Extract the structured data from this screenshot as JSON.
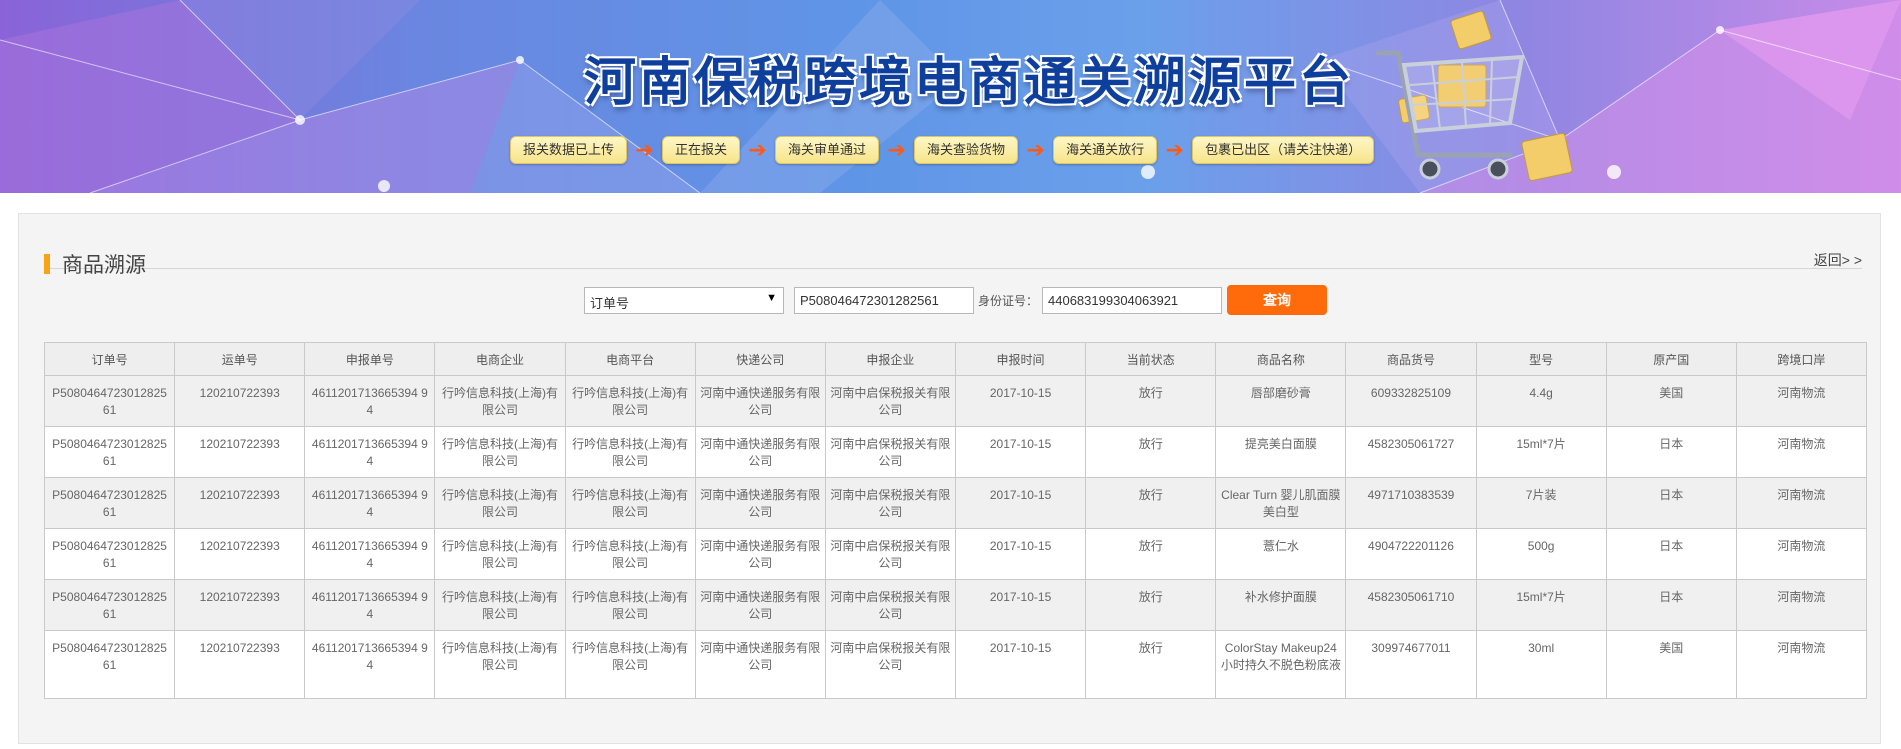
{
  "banner": {
    "title": "河南保税跨境电商通关溯源平台",
    "steps": [
      "报关数据已上传",
      "正在报关",
      "海关审单通过",
      "海关查验货物",
      "海关通关放行",
      "包裹已出区（请关注快递）"
    ]
  },
  "section": {
    "title": "商品溯源",
    "back_label": "返回> >"
  },
  "search": {
    "select_value": "订单号",
    "order_value": "P508046472301282561",
    "id_label": "身份证号：",
    "id_value": "440683199304063921",
    "query_label": "查询"
  },
  "table": {
    "headers": [
      "订单号",
      "运单号",
      "申报单号",
      "电商企业",
      "电商平台",
      "快递公司",
      "申报企业",
      "申报时间",
      "当前状态",
      "商品名称",
      "商品货号",
      "型号",
      "原产国",
      "跨境口岸"
    ],
    "rows": [
      [
        "P508046472301282561",
        "120210722393",
        "4611201713665394 94",
        "行吟信息科技(上海)有限公司",
        "行吟信息科技(上海)有限公司",
        "河南中通快递服务有限公司",
        "河南中启保税报关有限公司",
        "2017-10-15",
        "放行",
        "唇部磨砂膏",
        "609332825109",
        "4.4g",
        "美国",
        "河南物流"
      ],
      [
        "P508046472301282561",
        "120210722393",
        "4611201713665394 94",
        "行吟信息科技(上海)有限公司",
        "行吟信息科技(上海)有限公司",
        "河南中通快递服务有限公司",
        "河南中启保税报关有限公司",
        "2017-10-15",
        "放行",
        "提亮美白面膜",
        "4582305061727",
        "15ml*7片",
        "日本",
        "河南物流"
      ],
      [
        "P508046472301282561",
        "120210722393",
        "4611201713665394 94",
        "行吟信息科技(上海)有限公司",
        "行吟信息科技(上海)有限公司",
        "河南中通快递服务有限公司",
        "河南中启保税报关有限公司",
        "2017-10-15",
        "放行",
        "Clear Turn 婴儿肌面膜美白型",
        "4971710383539",
        "7片装",
        "日本",
        "河南物流"
      ],
      [
        "P508046472301282561",
        "120210722393",
        "4611201713665394 94",
        "行吟信息科技(上海)有限公司",
        "行吟信息科技(上海)有限公司",
        "河南中通快递服务有限公司",
        "河南中启保税报关有限公司",
        "2017-10-15",
        "放行",
        "薏仁水",
        "4904722201126",
        "500g",
        "日本",
        "河南物流"
      ],
      [
        "P508046472301282561",
        "120210722393",
        "4611201713665394 94",
        "行吟信息科技(上海)有限公司",
        "行吟信息科技(上海)有限公司",
        "河南中通快递服务有限公司",
        "河南中启保税报关有限公司",
        "2017-10-15",
        "放行",
        "补水修护面膜",
        "4582305061710",
        "15ml*7片",
        "日本",
        "河南物流"
      ],
      [
        "P508046472301282561",
        "120210722393",
        "4611201713665394 94",
        "行吟信息科技(上海)有限公司",
        "行吟信息科技(上海)有限公司",
        "河南中通快递服务有限公司",
        "河南中启保税报关有限公司",
        "2017-10-15",
        "放行",
        "ColorStay Makeup24小时持久不脱色粉底液",
        "309974677011",
        "30ml",
        "美国",
        "河南物流"
      ]
    ]
  },
  "colors": {
    "accent_orange": "#ff6a0a",
    "title_bar": "#f5a418",
    "title_blue": "#0f3f9c"
  }
}
